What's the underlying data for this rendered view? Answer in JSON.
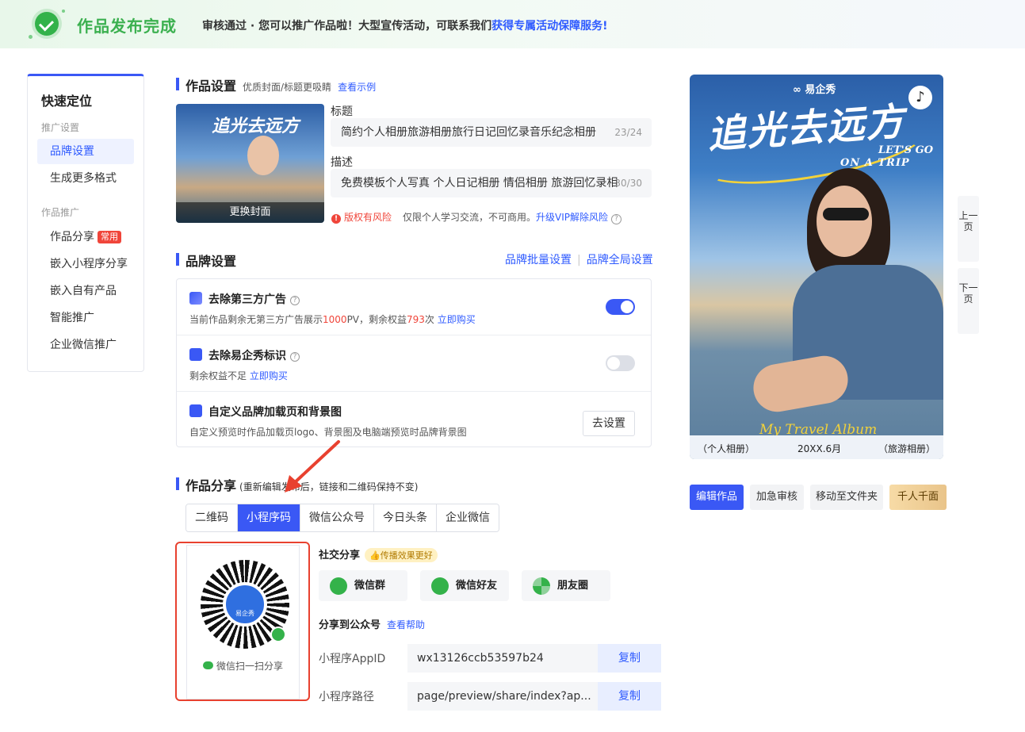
{
  "banner": {
    "title": "作品发布完成",
    "message": "审核通过 · 您可以推广作品啦！大型宣传活动，可联系我们",
    "link": "获得专属活动保障服务!"
  },
  "sidebar": {
    "title": "快速定位",
    "group1": "推广设置",
    "group2": "作品推广",
    "items": [
      {
        "label": "品牌设置"
      },
      {
        "label": "生成更多格式"
      },
      {
        "label": "作品分享",
        "tag": "常用"
      },
      {
        "label": "嵌入小程序分享"
      },
      {
        "label": "嵌入自有产品"
      },
      {
        "label": "智能推广"
      },
      {
        "label": "企业微信推广"
      }
    ]
  },
  "work_settings": {
    "title": "作品设置",
    "subtitle": "优质封面/标题更吸睛",
    "example_link": "查看示例",
    "cover_title": "追光去远方",
    "change_cover": "更换封面",
    "title_label": "标题",
    "title_value": "简约个人相册旅游相册旅行日记回忆录音乐纪念相册",
    "title_count": "23/24",
    "desc_label": "描述",
    "desc_value": "免费模板个人写真 个人日记相册 情侣相册 旅游回忆录相",
    "desc_count": "30/30",
    "risk": "版权有风险",
    "risk_note": "仅限个人学习交流，不可商用。",
    "vip_link": "升级VIP解除风险"
  },
  "brand": {
    "title": "品牌设置",
    "batch_link": "品牌批量设置",
    "global_link": "品牌全局设置",
    "rows": [
      {
        "title": "去除第三方广告",
        "desc_a": "当前作品剩余无第三方广告展示",
        "pv": "1000",
        "desc_b": "PV，剩余权益",
        "remain": "793",
        "desc_c": "次",
        "buy": "立即购买",
        "enabled": true
      },
      {
        "title": "去除易企秀标识",
        "desc_a": "剩余权益不足",
        "buy": "立即购买",
        "enabled": false
      },
      {
        "title": "自定义品牌加载页和背景图",
        "desc_a": "自定义预览时作品加载页logo、背景图及电脑端预览时品牌背景图",
        "button": "去设置"
      }
    ]
  },
  "share": {
    "title": "作品分享",
    "subtitle": "(重新编辑发布后，链接和二维码保持不变)",
    "tabs": [
      "二维码",
      "小程序码",
      "微信公众号",
      "今日头条",
      "企业微信"
    ],
    "active_tab": 1,
    "qr_brand": "易企秀",
    "qr_caption": "微信扫一扫分享",
    "social_title": "社交分享",
    "social_tag": "👍传播效果更好",
    "social_buttons": [
      "微信群",
      "微信好友",
      "朋友圈"
    ],
    "mp_title": "分享到公众号",
    "mp_help": "查看帮助",
    "appid_label": "小程序AppID",
    "appid_value": "wx13126ccb53597b24",
    "path_label": "小程序路径",
    "path_value": "page/preview/share/index?ap...",
    "copy": "复制"
  },
  "poster": {
    "brand": "∞ 易企秀",
    "title": "追光去远方",
    "eng1": "LET'S GO",
    "eng2": "ON A TRIP",
    "script": "My Travel Album",
    "bottom_left": "（个人相册）",
    "bottom_mid": "20XX.6月",
    "bottom_right": "（旅游相册）"
  },
  "actions": [
    "编辑作品",
    "加急审核",
    "移动至文件夹",
    "千人千面"
  ],
  "pager": {
    "prev": "上一页",
    "next": "下一页"
  }
}
